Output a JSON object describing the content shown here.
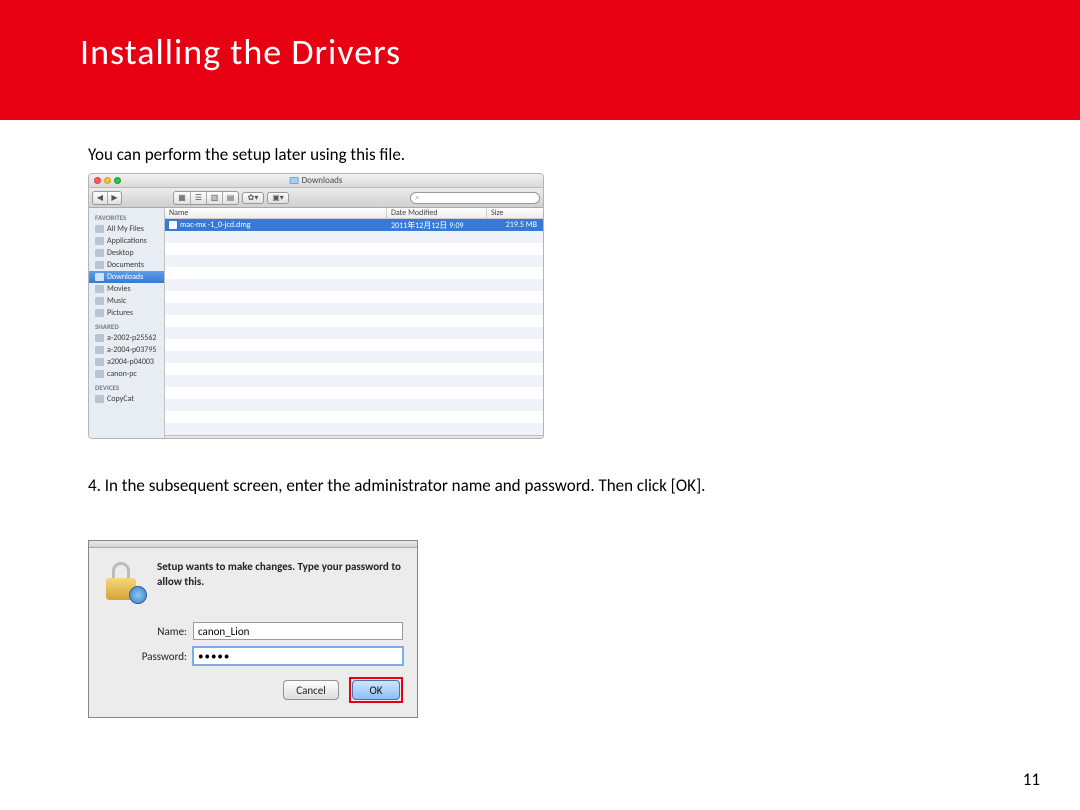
{
  "header": {
    "title": "Installing  the Drivers"
  },
  "intro": "You can perform the setup later using this file.",
  "step": "4. In the subsequent screen, enter the administrator name and password. Then click [OK].",
  "page_number": "11",
  "finder": {
    "window_title": "Downloads",
    "search_hint": " ",
    "columns": {
      "name": "Name",
      "date": "Date Modified",
      "size": "Size"
    },
    "sidebar": {
      "favorites_label": "FAVORITES",
      "favorites": [
        {
          "label": "All My Files"
        },
        {
          "label": "Applications"
        },
        {
          "label": "Desktop"
        },
        {
          "label": "Documents"
        },
        {
          "label": "Downloads",
          "selected": true
        },
        {
          "label": "Movies"
        },
        {
          "label": "Music"
        },
        {
          "label": "Pictures"
        }
      ],
      "shared_label": "SHARED",
      "shared": [
        {
          "label": "a-2002-p25562"
        },
        {
          "label": "a-2004-p03795"
        },
        {
          "label": "a2004-p04003"
        },
        {
          "label": "canon-pc"
        }
      ],
      "devices_label": "DEVICES",
      "devices": [
        {
          "label": "CopyCat"
        }
      ]
    },
    "file": {
      "name": "mac-mx   -1_0-jcd.dmg",
      "date": "2011年12月12日 9:09",
      "size": "219.5 MB"
    }
  },
  "auth": {
    "message": "Setup wants to make changes. Type your password to allow this.",
    "name_label": "Name:",
    "password_label": "Password:",
    "name_value": "canon_Lion",
    "password_masked": "•••••",
    "cancel": "Cancel",
    "ok": "OK"
  }
}
